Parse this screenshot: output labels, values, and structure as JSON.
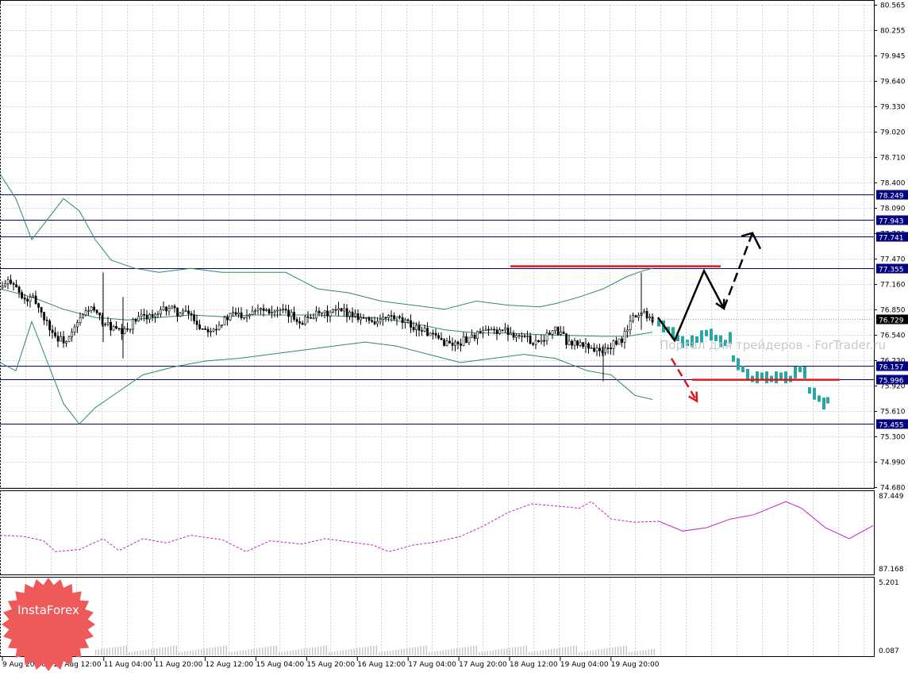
{
  "chart_data": [
    {
      "type": "candlestick",
      "title": "",
      "price_axis_labels": [
        "80.565",
        "80.255",
        "79.945",
        "79.640",
        "79.330",
        "79.020",
        "78.710",
        "78.400",
        "78.090",
        "77.780",
        "77.470",
        "77.160",
        "76.850",
        "76.540",
        "76.230",
        "75.920",
        "75.610",
        "75.300",
        "74.990",
        "74.680"
      ],
      "horizontal_levels": [
        {
          "value": 78.249,
          "label": "78.249"
        },
        {
          "value": 77.943,
          "label": "77.943"
        },
        {
          "value": 77.741,
          "label": "77.741"
        },
        {
          "value": 77.355,
          "label": "77.355"
        },
        {
          "value": 76.157,
          "label": "76.157"
        },
        {
          "value": 75.996,
          "label": "75.996"
        },
        {
          "value": 75.455,
          "label": "75.455"
        }
      ],
      "current_price": {
        "value": 76.729,
        "label": "76.729"
      },
      "time_axis_labels": [
        "9 Aug 20:00",
        "10 Aug 12:00",
        "11 Aug 04:00",
        "11 Aug 20:00",
        "12 Aug 12:00",
        "15 Aug 04:00",
        "15 Aug 20:00",
        "16 Aug 12:00",
        "17 Aug 04:00",
        "17 Aug 20:00",
        "18 Aug 12:00",
        "19 Aug 04:00",
        "19 Aug 20:00"
      ],
      "close_path": [
        [
          0,
          77.1
        ],
        [
          14,
          77.22
        ],
        [
          28,
          76.95
        ],
        [
          42,
          76.98
        ],
        [
          56,
          76.72
        ],
        [
          70,
          76.5
        ],
        [
          84,
          76.45
        ],
        [
          98,
          76.7
        ],
        [
          112,
          76.88
        ],
        [
          126,
          76.72
        ],
        [
          140,
          76.62
        ],
        [
          154,
          76.55
        ],
        [
          168,
          76.7
        ],
        [
          182,
          76.78
        ],
        [
          196,
          76.76
        ],
        [
          210,
          76.88
        ],
        [
          224,
          76.8
        ],
        [
          238,
          76.8
        ],
        [
          252,
          76.62
        ],
        [
          266,
          76.62
        ],
        [
          280,
          76.7
        ],
        [
          294,
          76.8
        ],
        [
          308,
          76.78
        ],
        [
          322,
          76.88
        ],
        [
          336,
          76.85
        ],
        [
          350,
          76.82
        ],
        [
          364,
          76.78
        ],
        [
          378,
          76.7
        ],
        [
          392,
          76.78
        ],
        [
          406,
          76.78
        ],
        [
          420,
          76.82
        ],
        [
          434,
          76.82
        ],
        [
          448,
          76.78
        ],
        [
          462,
          76.72
        ],
        [
          476,
          76.7
        ],
        [
          490,
          76.76
        ],
        [
          504,
          76.7
        ],
        [
          518,
          76.65
        ],
        [
          532,
          76.6
        ],
        [
          546,
          76.5
        ],
        [
          560,
          76.45
        ],
        [
          574,
          76.42
        ],
        [
          588,
          76.5
        ],
        [
          602,
          76.55
        ],
        [
          616,
          76.58
        ],
        [
          630,
          76.6
        ],
        [
          644,
          76.56
        ],
        [
          658,
          76.52
        ],
        [
          672,
          76.45
        ],
        [
          686,
          76.52
        ],
        [
          700,
          76.6
        ],
        [
          714,
          76.45
        ],
        [
          728,
          76.42
        ],
        [
          742,
          76.4
        ],
        [
          756,
          76.32
        ],
        [
          768,
          76.4
        ],
        [
          782,
          76.46
        ],
        [
          796,
          76.75
        ],
        [
          810,
          76.82
        ],
        [
          822,
          76.73
        ]
      ],
      "bollinger_bands": {
        "upper": [
          [
            0,
            78.5
          ],
          [
            20,
            78.2
          ],
          [
            40,
            77.7
          ],
          [
            60,
            77.95
          ],
          [
            80,
            78.2
          ],
          [
            100,
            78.05
          ],
          [
            120,
            77.7
          ],
          [
            140,
            77.45
          ],
          [
            170,
            77.35
          ],
          [
            200,
            77.3
          ],
          [
            240,
            77.35
          ],
          [
            280,
            77.3
          ],
          [
            320,
            77.3
          ],
          [
            360,
            77.3
          ],
          [
            400,
            77.1
          ],
          [
            440,
            77.05
          ],
          [
            480,
            76.95
          ],
          [
            520,
            76.9
          ],
          [
            560,
            76.85
          ],
          [
            600,
            76.95
          ],
          [
            640,
            76.9
          ],
          [
            680,
            76.88
          ],
          [
            700,
            76.92
          ],
          [
            730,
            77.0
          ],
          [
            760,
            77.1
          ],
          [
            790,
            77.25
          ],
          [
            810,
            77.32
          ],
          [
            822,
            77.35
          ]
        ],
        "middle": [
          [
            0,
            77.1
          ],
          [
            40,
            77.0
          ],
          [
            80,
            76.85
          ],
          [
            120,
            76.75
          ],
          [
            160,
            76.72
          ],
          [
            200,
            76.75
          ],
          [
            240,
            76.78
          ],
          [
            280,
            76.76
          ],
          [
            320,
            76.78
          ],
          [
            360,
            76.78
          ],
          [
            400,
            76.78
          ],
          [
            440,
            76.76
          ],
          [
            480,
            76.74
          ],
          [
            520,
            76.68
          ],
          [
            560,
            76.6
          ],
          [
            600,
            76.56
          ],
          [
            640,
            76.56
          ],
          [
            680,
            76.54
          ],
          [
            720,
            76.53
          ],
          [
            760,
            76.52
          ],
          [
            790,
            76.52
          ],
          [
            822,
            76.57
          ]
        ],
        "lower": [
          [
            0,
            76.2
          ],
          [
            20,
            76.1
          ],
          [
            40,
            76.7
          ],
          [
            60,
            76.2
          ],
          [
            80,
            75.7
          ],
          [
            100,
            75.45
          ],
          [
            120,
            75.65
          ],
          [
            150,
            75.85
          ],
          [
            180,
            76.05
          ],
          [
            220,
            76.15
          ],
          [
            260,
            76.22
          ],
          [
            300,
            76.25
          ],
          [
            340,
            76.3
          ],
          [
            380,
            76.35
          ],
          [
            420,
            76.4
          ],
          [
            460,
            76.45
          ],
          [
            500,
            76.4
          ],
          [
            540,
            76.3
          ],
          [
            580,
            76.2
          ],
          [
            620,
            76.25
          ],
          [
            660,
            76.3
          ],
          [
            700,
            76.25
          ],
          [
            740,
            76.1
          ],
          [
            770,
            76.05
          ],
          [
            800,
            75.8
          ],
          [
            822,
            75.75
          ]
        ]
      },
      "forecast_path": [
        [
          829,
          76.75
        ],
        [
          850,
          76.47
        ],
        [
          887,
          77.32
        ],
        [
          912,
          76.86
        ]
      ],
      "forecast_up_dashed": [
        [
          912,
          76.86
        ],
        [
          948,
          77.78
        ]
      ],
      "forecast_down_dashed": [
        [
          846,
          76.25
        ],
        [
          878,
          75.73
        ]
      ],
      "forecast_resistance_line": {
        "value": 77.375,
        "from_x": 643,
        "to_x": 908
      },
      "forecast_support_line": {
        "value": 75.99,
        "from_x": 872,
        "to_x": 1058
      },
      "projected_bars": [
        [
          828,
          76.68
        ],
        [
          834,
          76.64
        ],
        [
          840,
          76.6
        ],
        [
          846,
          76.56
        ],
        [
          852,
          76.5
        ],
        [
          858,
          76.45
        ],
        [
          864,
          76.44
        ],
        [
          870,
          76.46
        ],
        [
          876,
          76.48
        ],
        [
          882,
          76.52
        ],
        [
          888,
          76.56
        ],
        [
          894,
          76.54
        ],
        [
          900,
          76.5
        ],
        [
          906,
          76.46
        ],
        [
          912,
          76.44
        ],
        [
          918,
          76.5
        ],
        [
          922,
          76.25
        ],
        [
          928,
          76.18
        ],
        [
          934,
          76.12
        ],
        [
          940,
          76.05
        ],
        [
          946,
          76.0
        ],
        [
          952,
          76.02
        ],
        [
          958,
          76.04
        ],
        [
          964,
          76.02
        ],
        [
          970,
          76.0
        ],
        [
          976,
          76.02
        ],
        [
          982,
          76.04
        ],
        [
          988,
          76.02
        ],
        [
          994,
          76.0
        ],
        [
          1000,
          76.08
        ],
        [
          1006,
          76.12
        ],
        [
          1012,
          76.08
        ],
        [
          1018,
          75.86
        ],
        [
          1024,
          75.82
        ],
        [
          1030,
          75.76
        ],
        [
          1036,
          75.7
        ],
        [
          1041,
          75.74
        ]
      ]
    },
    {
      "type": "line",
      "title": "",
      "y_axis_labels": [
        "87.449",
        "87.168"
      ],
      "series": [
        {
          "values": [
            [
              0,
              37
            ],
            [
              30,
              38
            ],
            [
              55,
              42
            ],
            [
              70,
              52
            ],
            [
              100,
              50
            ],
            [
              130,
              40
            ],
            [
              150,
              51
            ],
            [
              180,
              40
            ],
            [
              210,
              44
            ],
            [
              240,
              37
            ],
            [
              280,
              41
            ],
            [
              310,
              52
            ],
            [
              340,
              42
            ],
            [
              380,
              45
            ],
            [
              410,
              40
            ],
            [
              440,
              43
            ],
            [
              470,
              46
            ],
            [
              490,
              52
            ],
            [
              520,
              46
            ],
            [
              550,
              43
            ],
            [
              580,
              38
            ],
            [
              610,
              28
            ],
            [
              640,
              16
            ],
            [
              670,
              8
            ],
            [
              700,
              10
            ],
            [
              730,
              12
            ],
            [
              745,
              6
            ],
            [
              770,
              22
            ],
            [
              800,
              25
            ],
            [
              830,
              24
            ]
          ]
        },
        {
          "values": [
            [
              830,
              24
            ],
            [
              860,
              33
            ],
            [
              890,
              30
            ],
            [
              920,
              22
            ],
            [
              950,
              18
            ],
            [
              990,
              6
            ],
            [
              1010,
              12
            ],
            [
              1040,
              30
            ],
            [
              1070,
              40
            ],
            [
              1100,
              28
            ]
          ]
        }
      ]
    },
    {
      "type": "bar",
      "title": "",
      "y_axis_labels": [
        "5.201",
        "0.087"
      ],
      "note_value": "0.087"
    }
  ],
  "watermark": {
    "text": "Портал для трейдеров - ForTrader.ru"
  },
  "logo": {
    "text": "InstaForex"
  },
  "colors": {
    "candle": "#000000",
    "bollinger": "#2e8b57",
    "level_line": "#000080",
    "label_bg": "#000080",
    "resistance": "#e0141b",
    "projection": "#2aa5a5",
    "oscillator": "#c81ec8",
    "grid": "#c8d2dc",
    "logo": "#ee5a5a"
  }
}
